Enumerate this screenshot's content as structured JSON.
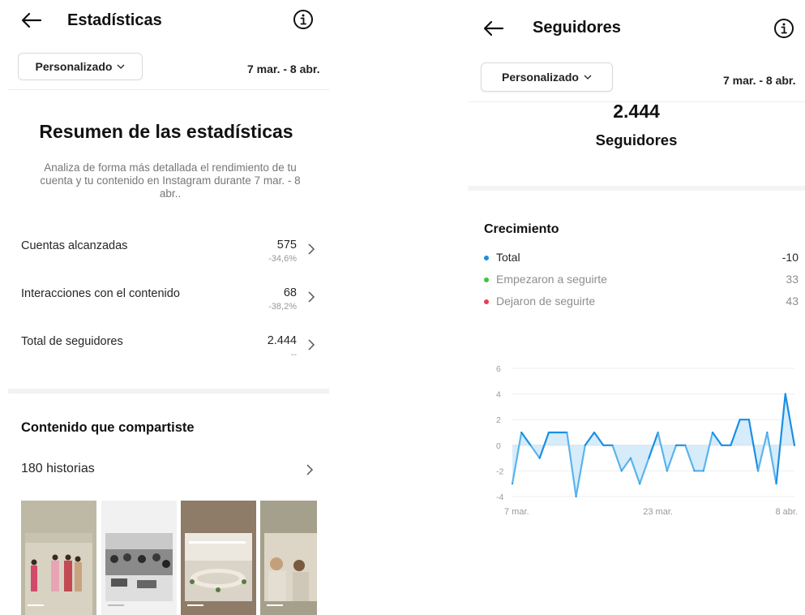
{
  "left": {
    "title": "Estadísticas",
    "dropdown_label": "Personalizado",
    "date_range": "7 mar. - 8 abr.",
    "summary_title": "Resumen de las estadísticas",
    "summary_desc": "Analiza de forma más detallada el rendimiento de tu cuenta y tu contenido en Instagram durante 7 mar. - 8 abr..",
    "metrics": [
      {
        "label": "Cuentas alcanzadas",
        "value": "575",
        "change": "-34,6%"
      },
      {
        "label": "Interacciones con el contenido",
        "value": "68",
        "change": "-38,2%"
      },
      {
        "label": "Total de seguidores",
        "value": "2.444",
        "change": "--"
      }
    ],
    "content_title": "Contenido que compartiste",
    "stories_label": "180 historias"
  },
  "right": {
    "title": "Seguidores",
    "dropdown_label": "Personalizado",
    "date_range": "7 mar. - 8 abr.",
    "followers_count": "2.444",
    "followers_label": "Seguidores",
    "growth_title": "Crecimiento",
    "legend": [
      {
        "label": "Total",
        "value": "-10",
        "color": "#1a8fe3",
        "muted": false
      },
      {
        "label": "Empezaron a seguirte",
        "value": "33",
        "color": "#3ec43e",
        "muted": true
      },
      {
        "label": "Dejaron de seguirte",
        "value": "43",
        "color": "#ea3e52",
        "muted": true
      }
    ]
  },
  "icons": {
    "back": "back-arrow-icon",
    "info": "info-icon",
    "dropdown": "chevron-down-icon",
    "row": "chevron-right-icon"
  },
  "colors": {
    "accent": "#1a8fe3",
    "area_fill": "#d6ecfb"
  },
  "chart_data": {
    "type": "area",
    "series": [
      {
        "values": [
          -3,
          1,
          0,
          -1,
          1,
          1,
          1,
          -4,
          0,
          1,
          0,
          0,
          -2,
          -1,
          -3,
          -1,
          1,
          -2,
          0,
          0,
          -2,
          -2,
          1,
          0,
          0,
          2,
          2,
          -2,
          1,
          -3,
          4,
          0
        ]
      }
    ],
    "x_tick_labels": [
      "7 mar.",
      "23 mar.",
      "8 abr."
    ],
    "ylim": [
      -4,
      6
    ],
    "y_ticks": [
      6,
      4,
      2,
      0,
      -2,
      -4
    ],
    "grid": true,
    "legend": "none"
  }
}
